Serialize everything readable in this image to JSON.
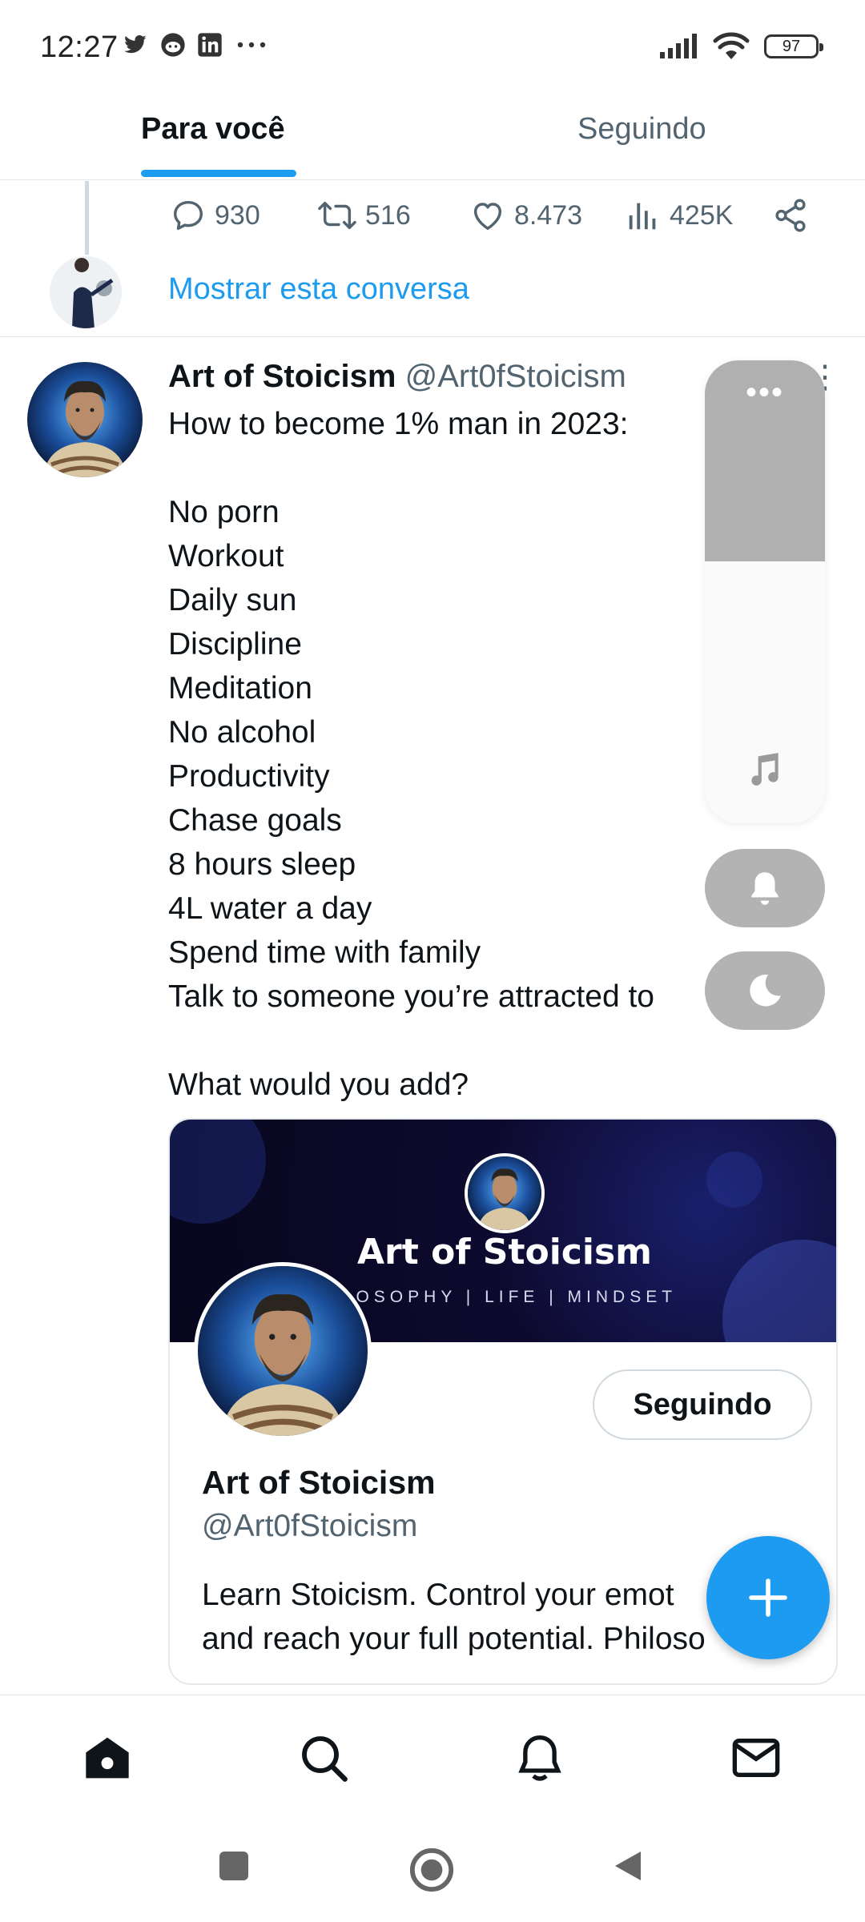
{
  "status_bar": {
    "time": "12:27",
    "battery": "97",
    "left_icons": [
      "twitter-bird-icon",
      "reddit-icon",
      "linkedin-icon",
      "more-dots-icon"
    ],
    "right_icons": [
      "signal-icon",
      "wifi-icon",
      "battery-icon"
    ]
  },
  "tabs": [
    {
      "label": "Para você",
      "active": true
    },
    {
      "label": "Seguindo",
      "active": false
    }
  ],
  "previous_tweet": {
    "replies": "930",
    "retweets": "516",
    "likes": "8.473",
    "views": "425K",
    "show_conversation": "Mostrar esta conversa"
  },
  "tweet": {
    "name": "Art of Stoicism",
    "handle": "@Art0fStoicism",
    "intro": "How to become 1% man in 2023:",
    "items": [
      "No porn",
      "Workout",
      "Daily sun",
      "Discipline",
      "Meditation",
      "No alcohol",
      "Productivity",
      "Chase goals",
      "8 hours sleep",
      "4L water a day",
      "Spend time with family",
      "Talk to someone you’re attracted to"
    ],
    "closing": "What would you add?"
  },
  "card": {
    "banner_title": "Art of Stoicism",
    "banner_subtitle": "ILOSOPHY | LIFE | MINDSET",
    "follow_button": "Seguindo",
    "name": "Art of Stoicism",
    "handle": "@Art0fStoicism",
    "bio_line1": "Learn Stoicism. Control your emot",
    "bio_line2": "and reach your full potential. Philoso"
  },
  "overlay": {
    "volume_level": 0.58,
    "icons": [
      "more-dots-icon",
      "music-note-icon",
      "bell-icon",
      "moon-icon"
    ]
  },
  "colors": {
    "accent": "#1d9bf0",
    "text_primary": "#0f1419",
    "text_secondary": "#536471"
  },
  "bottom_nav": [
    "home-icon",
    "search-icon",
    "notifications-icon",
    "messages-icon"
  ],
  "system_nav": [
    "recents-square-icon",
    "home-circle-icon",
    "back-triangle-icon"
  ]
}
